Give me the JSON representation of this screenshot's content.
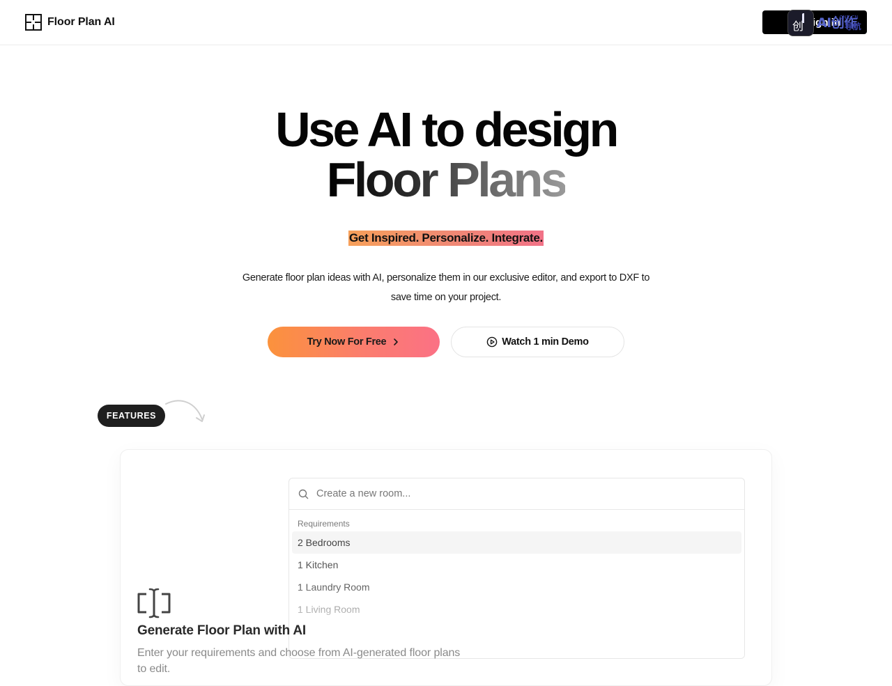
{
  "header": {
    "brand": "Floor Plan AI",
    "signin_label": "Sign in",
    "overlay_badge": {
      "icon_char": "创",
      "main_text": "AI创作",
      "sub_text": "导航",
      "tiny_text": "CNZ.CN"
    }
  },
  "hero": {
    "title_line1": "Use AI to design",
    "title_line2": "Floor Plans",
    "tagline": "Get Inspired. Personalize. Integrate.",
    "description": "Generate floor plan ideas with AI, personalize them in our exclusive editor, and export to DXF to save time on your project.",
    "primary_cta": "Try Now For Free",
    "secondary_cta": "Watch 1 min Demo"
  },
  "features": {
    "pill_label": "FEATURES",
    "card": {
      "search_placeholder": "Create a new room...",
      "group_label": "Requirements",
      "items": [
        "2 Bedrooms",
        "1 Kitchen",
        "1 Laundry Room",
        "1 Living Room"
      ],
      "title": "Generate Floor Plan with AI",
      "description": "Enter your requirements and choose from AI-generated floor plans to edit."
    }
  },
  "colors": {
    "accent_gradient_start": "#fb923c",
    "accent_gradient_end": "#fb7185",
    "text_primary": "#0a0a0a",
    "pill_background": "#1f1f1f"
  },
  "icons": {
    "logo": "floor-plan-logo-icon",
    "primary_cta": "chevron-right-icon",
    "secondary_cta": "play-circle-icon",
    "search": "search-icon",
    "feature": "text-cursor-icon",
    "decoration": "curved-arrow-icon"
  }
}
